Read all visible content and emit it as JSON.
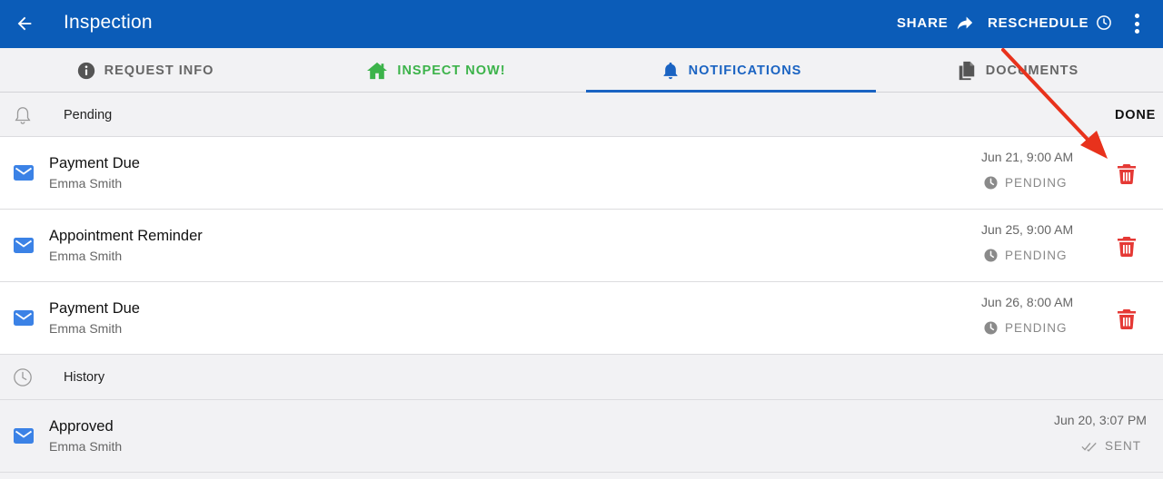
{
  "appbar": {
    "title": "Inspection",
    "back_icon": "arrow-left-icon",
    "share_label": "SHARE",
    "share_icon": "share-arrow-icon",
    "reschedule_label": "RESCHEDULE",
    "reschedule_icon": "clock-icon",
    "more_icon": "more-vert-icon",
    "color": "#0b5cb8"
  },
  "tabs": [
    {
      "label": "REQUEST INFO",
      "icon": "info-icon",
      "active": false
    },
    {
      "label": "INSPECT NOW!",
      "icon": "home-icon",
      "active": false,
      "color": "#3cb34a"
    },
    {
      "label": "NOTIFICATIONS",
      "icon": "bell-icon",
      "active": true,
      "color": "#1a63c2"
    },
    {
      "label": "DOCUMENTS",
      "icon": "documents-icon",
      "active": false
    }
  ],
  "pending": {
    "label": "Pending",
    "icon": "bell-outline-icon",
    "done_label": "DONE",
    "items": [
      {
        "subject": "Payment Due",
        "recipient": "Emma Smith",
        "date": "Jun 21, 9:00 AM",
        "status": "PENDING"
      },
      {
        "subject": "Appointment Reminder",
        "recipient": "Emma Smith",
        "date": "Jun 25, 9:00 AM",
        "status": "PENDING"
      },
      {
        "subject": "Payment Due",
        "recipient": "Emma Smith",
        "date": "Jun 26, 8:00 AM",
        "status": "PENDING"
      }
    ]
  },
  "history": {
    "label": "History",
    "icon": "clock-outline-icon",
    "items": [
      {
        "subject": "Approved",
        "recipient": "Emma Smith",
        "date": "Jun 20, 3:07 PM",
        "status": "SENT"
      }
    ]
  },
  "colors": {
    "delete": "#e53935",
    "mail": "#3b82e6",
    "annotation_arrow": "#e8321c"
  }
}
